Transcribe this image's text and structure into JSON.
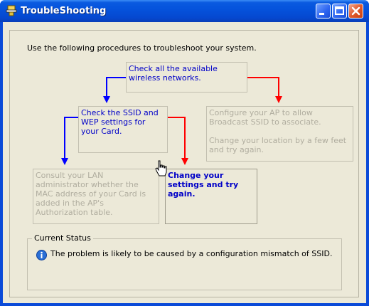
{
  "window": {
    "title": "TroubleShooting"
  },
  "intro": "Use the following procedures to troubleshoot your system.",
  "steps": {
    "check_networks": "Check all the available wireless networks.",
    "check_ssid": "Check the SSID and WEP settings for your Card.",
    "configure_ap": "Configure your AP to allow Broadcast SSID to associate.",
    "change_location": "Change your location by a few feet and try again.",
    "consult_admin": "Consult your LAN administrator whether the MAC address of your Card is added in the AP's Authorization table.",
    "change_settings": "Change your settings and try again."
  },
  "status": {
    "legend": "Current Status",
    "message": "The problem is likely to be caused by a configuration mismatch of SSID."
  },
  "icons": [
    "app-icon",
    "minimize-icon",
    "maximize-icon",
    "close-icon",
    "info-icon",
    "hand-cursor-icon"
  ],
  "colors": {
    "title_bar": "#0553dc",
    "face": "#ece9d8",
    "link_blue": "#0000c8",
    "disabled_gray": "#b0ad9f",
    "arrow_blue": "#0000ff",
    "arrow_red": "#ff0000"
  }
}
